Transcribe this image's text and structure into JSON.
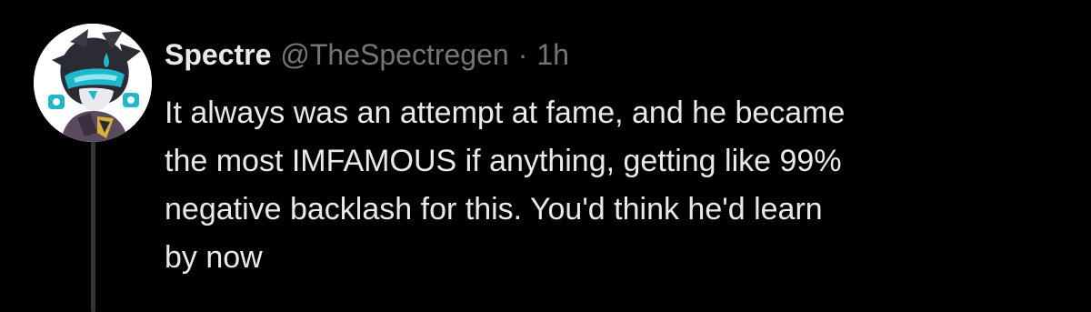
{
  "colors": {
    "background": "#000000",
    "primary_text": "#e7e9ea",
    "secondary_text": "#71767b",
    "thread_line": "#333639"
  },
  "tweet": {
    "avatar_icon": "user-avatar-icon",
    "display_name": "Spectre",
    "handle": "@TheSpectregen",
    "separator": "·",
    "time": "1h",
    "text_lines": [
      "It always was an attempt at fame, and he became",
      "the most IMFAMOUS if anything, getting like 99%",
      "negative backlash for this. You'd think he'd learn",
      "by now"
    ]
  }
}
